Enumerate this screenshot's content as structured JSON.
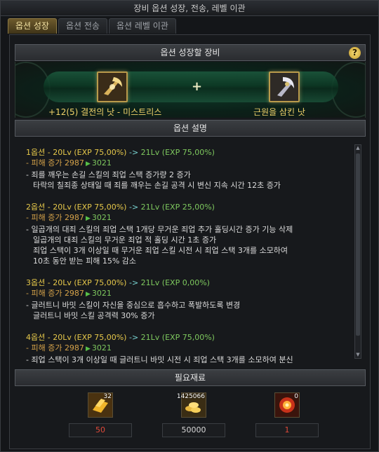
{
  "window": {
    "title": "장비 옵션 성장, 전송, 레벨 이관"
  },
  "tabs": [
    {
      "label": "옵션 성장",
      "active": true
    },
    {
      "label": "옵션 전송",
      "active": false
    },
    {
      "label": "옵션 레벨 이관",
      "active": false
    }
  ],
  "equipment": {
    "header": "옵션 성장할 장비",
    "help_label": "?",
    "plus": "+",
    "left_item": {
      "name": "+12(5) 결전의 낫 - 미스트리스",
      "icon": "scythe-icon"
    },
    "right_item": {
      "name": "근원을 삼킨 낫",
      "icon": "scythe-icon"
    }
  },
  "description": {
    "header": "옵션 설명",
    "options": [
      {
        "title_prefix": "1옵션 - 20Lv (EXP 75,00%)",
        "arrow": " -> ",
        "title_suffix": "21Lv (EXP 75,00%)",
        "damage_prefix": "- 피해 증가 2987",
        "damage_after": "3021",
        "lines": [
          "- 죄를 깨우는 손길 스킬의 죄업 스택 증가량 2 증가",
          "타락의 칠죄종 상태일 때 죄를 깨우는 손길 공격 시 변신 지속 시간 12초 증가"
        ]
      },
      {
        "title_prefix": "2옵션 - 20Lv (EXP 75,00%)",
        "arrow": " -> ",
        "title_suffix": "21Lv (EXP 25,00%)",
        "damage_prefix": "- 피해 증가 2987",
        "damage_after": "3021",
        "lines": [
          "- 일곱개의 대죄 스킬의 죄업 스택 1개당 무거운 죄업 추가 홀딩시간 증가 기능 삭제",
          "일곱개의 대죄 스킬의 무거운 죄업 적 홀딩 시간 1초 증가",
          "죄업 스택이 3개 이상일 때 무거운 죄업 스킬 시전 시 죄업 스택 3개를 소모하여",
          "10초 동안 받는 피해 15% 감소"
        ]
      },
      {
        "title_prefix": "3옵션 - 20Lv (EXP 75,00%)",
        "arrow": " -> ",
        "title_suffix": "21Lv (EXP 0,00%)",
        "damage_prefix": "- 피해 증가 2987",
        "damage_after": "3021",
        "lines": [
          "- 글러트니 바밋 스킬이 자신을 중심으로 흡수하고 폭발하도록 변경",
          "글러트니 바밋 스킬 공격력 30% 증가"
        ]
      },
      {
        "title_prefix": "4옵션 - 20Lv (EXP 75,00%)",
        "arrow": " -> ",
        "title_suffix": "21Lv (EXP 75,00%)",
        "damage_prefix": "- 피해 증가 2987",
        "damage_after": "3021",
        "lines": [
          "- 죄업 스택이 3개 이상일 때 글러트니 바밋 시전 시 죄업 스택 3개를 소모하여 분신"
        ]
      }
    ]
  },
  "materials": {
    "header": "필요재료",
    "items": [
      {
        "icon": "gold-bars-icon",
        "badge": "32",
        "value": "50",
        "color": "#e04a3a"
      },
      {
        "icon": "gold-coins-icon",
        "badge": "1425066",
        "value": "50000",
        "color": "#d8d8d8"
      },
      {
        "icon": "fire-orb-icon",
        "badge": "0",
        "value": "1",
        "color": "#e04a3a"
      }
    ]
  }
}
